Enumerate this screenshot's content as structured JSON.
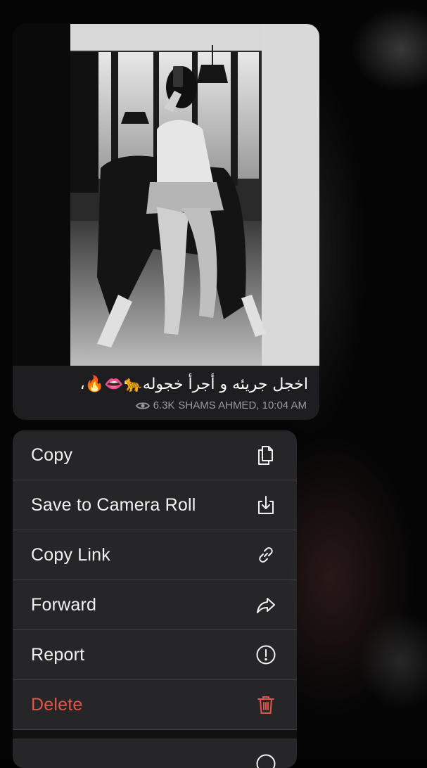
{
  "message": {
    "caption": "اخجل جريئه و أجرأ خجوله🐆👄🔥،",
    "views": "6.3K",
    "author_time": "SHAMS AHMED, 10:04 AM",
    "view_icon": "eye-icon",
    "photo": "black-and-white photo of a woman seated on a man's lap taking a mirror selfie"
  },
  "menu": {
    "items": [
      {
        "label": "Copy",
        "icon": "copy-icon"
      },
      {
        "label": "Save to Camera Roll",
        "icon": "save-download-icon"
      },
      {
        "label": "Copy Link",
        "icon": "link-icon"
      },
      {
        "label": "Forward",
        "icon": "forward-arrow-icon"
      },
      {
        "label": "Report",
        "icon": "report-exclamation-icon"
      },
      {
        "label": "Delete",
        "icon": "trash-icon"
      }
    ]
  },
  "colors": {
    "menu_background": "#28282a",
    "danger": "#e2554a",
    "meta_text": "#9a9aa0"
  }
}
